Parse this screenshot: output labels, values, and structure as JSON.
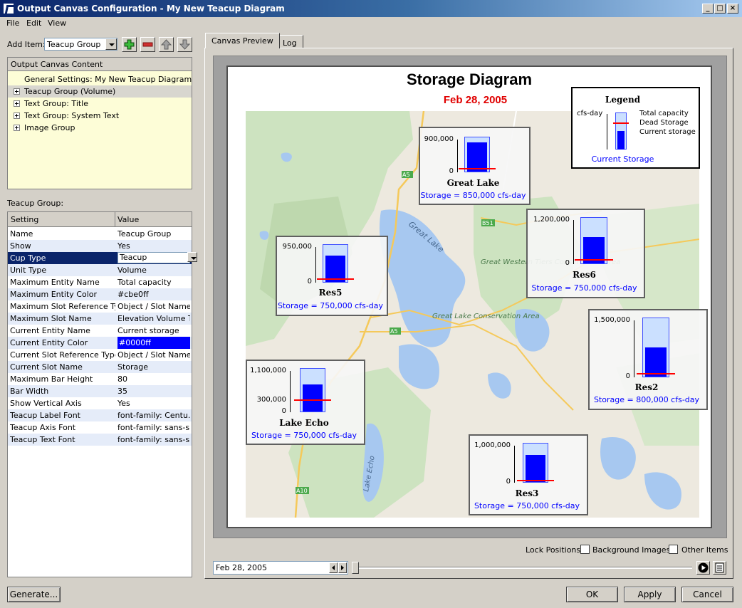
{
  "window": {
    "title": "Output Canvas Configuration - My New Teacup Diagram"
  },
  "menu": [
    "File",
    "Edit",
    "View"
  ],
  "left": {
    "add_item_label": "Add Item:",
    "add_item_value": "Teacup Group",
    "tree_header": "Output Canvas Content",
    "tree_items": [
      "General Settings: My New Teacup Diagram",
      "Teacup Group (Volume)",
      "Text Group: Title",
      "Text Group: System Text",
      "Image Group"
    ],
    "section_label": "Teacup Group:",
    "prop_headers": [
      "Setting",
      "Value"
    ],
    "props": [
      [
        "Name",
        "Teacup Group"
      ],
      [
        "Show",
        "Yes"
      ],
      [
        "Cup Type",
        "Teacup"
      ],
      [
        "Unit Type",
        "Volume"
      ],
      [
        "Maximum Entity Name",
        "Total capacity"
      ],
      [
        "Maximum Entity Color",
        "#cbe0ff"
      ],
      [
        "Maximum Slot Reference Type",
        "Object / Slot Name"
      ],
      [
        "Maximum Slot Name",
        "Elevation Volume T..."
      ],
      [
        "Current Entity Name",
        "Current storage"
      ],
      [
        "Current Entity Color",
        "#0000ff"
      ],
      [
        "Current Slot Reference Type",
        "Object / Slot Name"
      ],
      [
        "Current Slot Name",
        "Storage"
      ],
      [
        "Maximum Bar Height",
        "80"
      ],
      [
        "Bar Width",
        "35"
      ],
      [
        "Show Vertical Axis",
        "Yes"
      ],
      [
        "Teacup Label Font",
        "font-family: Centu..."
      ],
      [
        "Teacup Axis Font",
        "font-family: sans-s..."
      ],
      [
        "Teacup Text Font",
        "font-family: sans-s..."
      ]
    ],
    "generate_label": "Generate..."
  },
  "tabs": [
    "Canvas Preview",
    "Log"
  ],
  "diagram": {
    "title": "Storage Diagram",
    "date": "Feb 28, 2005",
    "legend": {
      "title": "Legend",
      "unit": "cfs-day",
      "items": [
        "Total capacity",
        "Dead Storage",
        "Current storage"
      ],
      "footer": "Current Storage"
    },
    "teacups": [
      {
        "name": "Great Lake",
        "top_tick": "900,000",
        "bottom_tick": "0",
        "storage": "Storage = 850,000 cfs-day",
        "fill": 0.93,
        "dead": 0.08
      },
      {
        "name": "Res6",
        "top_tick": "1,200,000",
        "bottom_tick": "0",
        "storage": "Storage = 750,000 cfs-day",
        "fill": 0.62,
        "dead": 0.08
      },
      {
        "name": "Res5",
        "top_tick": "950,000",
        "bottom_tick": "0",
        "storage": "Storage = 750,000 cfs-day",
        "fill": 0.78,
        "dead": 0.08
      },
      {
        "name": "Res2",
        "top_tick": "1,500,000",
        "bottom_tick": "0",
        "storage": "Storage = 800,000 cfs-day",
        "fill": 0.53,
        "dead": 0.05
      },
      {
        "name": "Lake Echo",
        "top_tick": "1,100,000",
        "mid_tick": "300,000",
        "bottom_tick": "0",
        "storage": "Storage = 750,000 cfs-day",
        "fill": 0.68,
        "dead": 0.27
      },
      {
        "name": "Res3",
        "top_tick": "1,000,000",
        "bottom_tick": "0",
        "storage": "Storage = 750,000 cfs-day",
        "fill": 0.75,
        "dead": 0.03
      }
    ],
    "map_labels": [
      "Great Lake",
      "Great Western Tiers Conservation Area",
      "Great Lake Conservation Area",
      "Lake Echo",
      "A5",
      "A5",
      "B51",
      "A10"
    ]
  },
  "bottom": {
    "lock_label": "Lock Positions:",
    "lock_bg": "Background Images",
    "lock_other": "Other Items",
    "date_value": "Feb 28, 2005"
  },
  "buttons": {
    "ok": "OK",
    "apply": "Apply",
    "cancel": "Cancel"
  },
  "colors": {
    "max_entity": "#cbe0ff",
    "current_entity": "#0000ff",
    "dead_storage": "#ff0000",
    "date": "#e00000"
  }
}
